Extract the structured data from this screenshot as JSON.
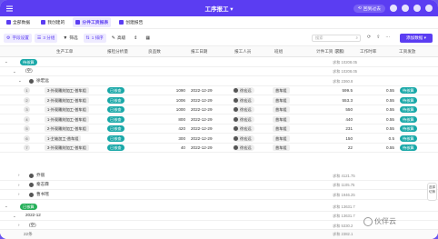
{
  "window": {
    "title": "工序报工",
    "share_label": "回到过去",
    "window_controls": [
      "history-icon",
      "gift-icon",
      "user-icon",
      "info-icon",
      "close-icon"
    ]
  },
  "tabs": [
    {
      "label": "全部数据",
      "active": false
    },
    {
      "label": "我创建的",
      "active": false
    },
    {
      "label": "分件工资报表",
      "active": true
    },
    {
      "label": "创建报告",
      "active": false
    }
  ],
  "toolbar": {
    "field_settings": "字段设置",
    "group": "3 分组",
    "filter": "筛选",
    "sort": "1 排序",
    "highlight": "高级",
    "search_placeholder": "搜索",
    "add_button": "添加数据"
  },
  "columns": {
    "work_order": "生产工单",
    "process_tag": "报检分析量",
    "qty": "良品数",
    "report_date": "报工日期",
    "reporter": "报工人员",
    "team": "班组",
    "piece_wage": "计件工资",
    "piece_wage_badge": "求和",
    "rate": "工作时率",
    "status": "工资发放"
  },
  "groups": [
    {
      "label": "待核算",
      "summary": "求和 10208.05"
    },
    {
      "label": "(空)",
      "summary": "求和 10208.05"
    },
    {
      "label": "徐宏远",
      "summary": "求和 2360.8"
    }
  ],
  "rows": [
    {
      "idx": "1",
      "order": "3-外观雕刻加工-普车组",
      "tag": "已核查",
      "qty": "1090",
      "date": "2022-12-29",
      "person": "徐宏远",
      "team": "普车组",
      "wage": "599.5",
      "rate": "0.55",
      "status": "待核算"
    },
    {
      "idx": "2",
      "order": "2-外观雕刻加工-普车组",
      "tag": "已核查",
      "qty": "1006",
      "date": "2022-12-29",
      "person": "徐宏远",
      "team": "普车组",
      "wage": "553.3",
      "rate": "0.55",
      "status": "待核算"
    },
    {
      "idx": "3",
      "order": "1-外观雕刻加工-普车组",
      "tag": "已核查",
      "qty": "1000",
      "date": "2022-12-29",
      "person": "徐宏远",
      "team": "普车组",
      "wage": "550",
      "rate": "0.55",
      "status": "待核算"
    },
    {
      "idx": "4",
      "order": "1-外观雕刻加工-普车组",
      "tag": "已核查",
      "qty": "800",
      "date": "2022-12-29",
      "person": "徐宏远",
      "team": "普车组",
      "wage": "440",
      "rate": "0.55",
      "status": "待核算"
    },
    {
      "idx": "5",
      "order": "2-外观雕刻加工-普车组",
      "tag": "已核查",
      "qty": "420",
      "date": "2022-12-29",
      "person": "徐宏远",
      "team": "普车组",
      "wage": "231",
      "rate": "0.55",
      "status": "待核算"
    },
    {
      "idx": "6",
      "order": "1-主轴加工-普车组",
      "tag": "已核查",
      "qty": "300",
      "date": "2022-12-29",
      "person": "徐宏远",
      "team": "普车组",
      "wage": "150",
      "rate": "0.5",
      "status": "待核算"
    },
    {
      "idx": "7",
      "order": "3-外观雕刻加工-普车组",
      "tag": "已核查",
      "qty": "40",
      "date": "2022-12-29",
      "person": "徐宏远",
      "team": "普车组",
      "wage": "22",
      "rate": "0.55",
      "status": "待核算"
    }
  ],
  "people_groups": [
    {
      "name": "乔丽",
      "summary": "求和 4121.75"
    },
    {
      "name": "秦志霖",
      "summary": "求和 1105.75"
    },
    {
      "name": "曹书瑶",
      "summary": "求和 1946.25"
    }
  ],
  "bottom_groups": [
    {
      "label": "已核算",
      "summary": "求和 13631.7"
    },
    {
      "label": "2022-12",
      "summary": "求和 13631.7"
    },
    {
      "label": "(空)",
      "summary": "求和 5330.2"
    },
    {
      "label": "",
      "summary": "求和 2382.1"
    }
  ],
  "footer": {
    "count_label": "22条"
  },
  "side_control": "选择\n切换",
  "watermark": "伙伴云"
}
